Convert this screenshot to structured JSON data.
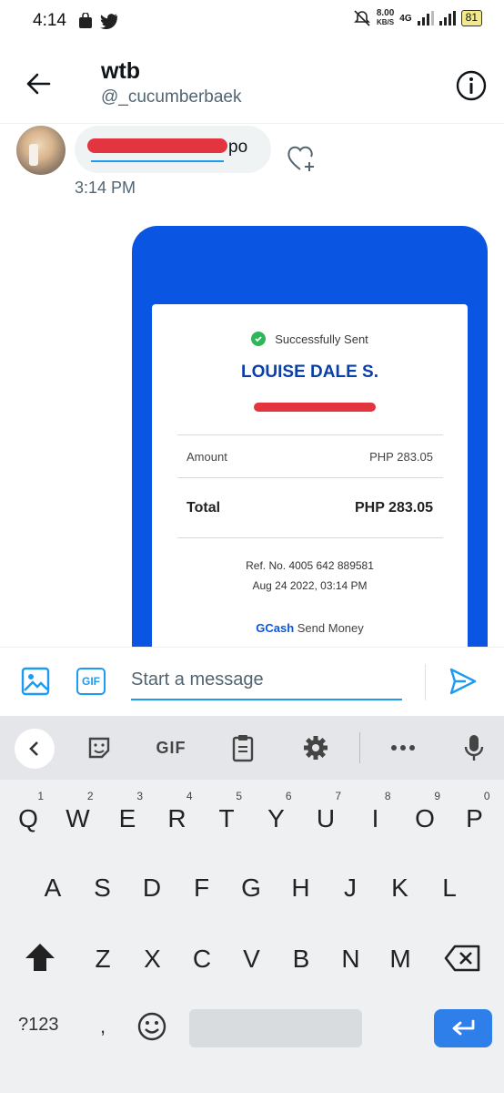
{
  "status_bar": {
    "time": "4:14",
    "net_speed_value": "8.00",
    "net_speed_unit": "KB/S",
    "network": "4G",
    "battery": "81"
  },
  "header": {
    "title": "wtb",
    "handle": "@_cucumberbaek"
  },
  "conversation": {
    "message_suffix": "po",
    "message_time": "3:14 PM",
    "receipt": {
      "status": "Successfully Sent",
      "recipient": "LOUISE DALE S.",
      "amount_label": "Amount",
      "amount_value": "PHP 283.05",
      "total_label": "Total",
      "total_value": "PHP 283.05",
      "ref": "Ref. No. 4005 642 889581",
      "date": "Aug 24 2022, 03:14 PM",
      "brand": "GCash",
      "service": "Send Money"
    }
  },
  "composer": {
    "gif_label": "GIF",
    "placeholder": "Start a message"
  },
  "keyboard": {
    "toolbar_gif": "GIF",
    "row1": [
      {
        "key": "Q",
        "hint": "1"
      },
      {
        "key": "W",
        "hint": "2"
      },
      {
        "key": "E",
        "hint": "3"
      },
      {
        "key": "R",
        "hint": "4"
      },
      {
        "key": "T",
        "hint": "5"
      },
      {
        "key": "Y",
        "hint": "6"
      },
      {
        "key": "U",
        "hint": "7"
      },
      {
        "key": "I",
        "hint": "8"
      },
      {
        "key": "O",
        "hint": "9"
      },
      {
        "key": "P",
        "hint": "0"
      }
    ],
    "row2": [
      "A",
      "S",
      "D",
      "F",
      "G",
      "H",
      "J",
      "K",
      "L"
    ],
    "row3": [
      "Z",
      "X",
      "C",
      "V",
      "B",
      "N",
      "M"
    ],
    "symbols_label": "?123",
    "comma": ","
  },
  "colors": {
    "accent": "#1d9bf0",
    "gcash_blue": "#0a56e3",
    "redaction": "#e2353f",
    "success": "#2fb55a"
  },
  "icons": [
    "back-arrow-icon",
    "info-icon",
    "heart-plus-icon",
    "image-icon",
    "send-icon",
    "chevron-left-icon",
    "sticker-icon",
    "clipboard-icon",
    "gear-icon",
    "more-icon",
    "mic-icon",
    "shift-icon",
    "backspace-icon",
    "emoji-icon",
    "enter-icon"
  ]
}
